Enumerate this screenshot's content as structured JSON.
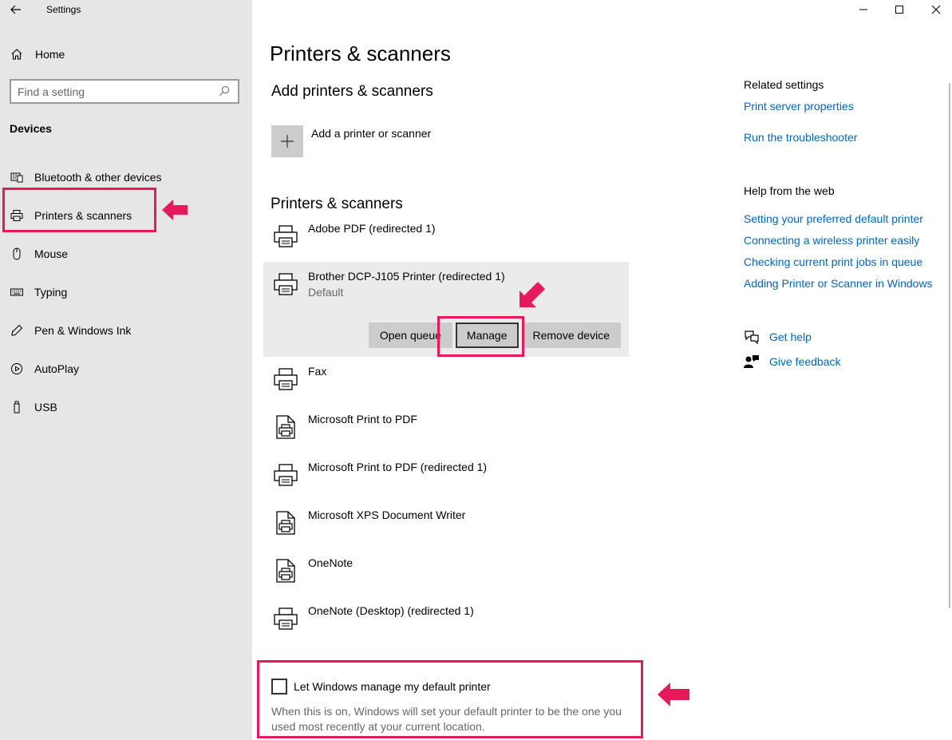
{
  "app": {
    "title": "Settings"
  },
  "sidebar": {
    "home_label": "Home",
    "search_placeholder": "Find a setting",
    "section_label": "Devices",
    "items": [
      {
        "label": "Bluetooth & other devices",
        "icon": "bluetooth-devices-icon"
      },
      {
        "label": "Printers & scanners",
        "icon": "printer-icon",
        "active": true
      },
      {
        "label": "Mouse",
        "icon": "mouse-icon"
      },
      {
        "label": "Typing",
        "icon": "keyboard-icon"
      },
      {
        "label": "Pen & Windows Ink",
        "icon": "pen-icon"
      },
      {
        "label": "AutoPlay",
        "icon": "autoplay-icon"
      },
      {
        "label": "USB",
        "icon": "usb-icon"
      }
    ]
  },
  "main": {
    "title": "Printers & scanners",
    "add_section_title": "Add printers & scanners",
    "add_label": "Add a printer or scanner",
    "list_title": "Printers & scanners",
    "printers": [
      {
        "name": "Adobe PDF (redirected 1)",
        "icon": "printer-icon"
      },
      {
        "name": "Brother DCP-J105 Printer (redirected 1)",
        "sub": "Default",
        "icon": "printer-icon",
        "expanded": true
      },
      {
        "name": "Fax",
        "icon": "printer-icon"
      },
      {
        "name": "Microsoft Print to PDF",
        "icon": "document-printer-icon"
      },
      {
        "name": "Microsoft Print to PDF (redirected 1)",
        "icon": "printer-icon"
      },
      {
        "name": "Microsoft XPS Document Writer",
        "icon": "document-printer-icon"
      },
      {
        "name": "OneNote",
        "icon": "document-printer-icon"
      },
      {
        "name": "OneNote (Desktop) (redirected 1)",
        "icon": "printer-icon"
      }
    ],
    "actions": {
      "open_queue": "Open queue",
      "manage": "Manage",
      "remove": "Remove device"
    },
    "default_printer": {
      "label": "Let Windows manage my default printer",
      "description": "When this is on, Windows will set your default printer to be the one you used most recently at your current location.",
      "checked": false
    }
  },
  "right": {
    "related_title": "Related settings",
    "related_links": [
      "Print server properties",
      "Run the troubleshooter"
    ],
    "web_title": "Help from the web",
    "web_links": [
      "Setting your preferred default printer",
      "Connecting a wireless printer easily",
      "Checking current print jobs in queue",
      "Adding Printer or Scanner in Windows"
    ],
    "get_help": "Get help",
    "give_feedback": "Give feedback"
  },
  "colors": {
    "accent": "#0067b8",
    "highlight": "#e8195a",
    "sidebar_bg": "#e6e6e6"
  }
}
